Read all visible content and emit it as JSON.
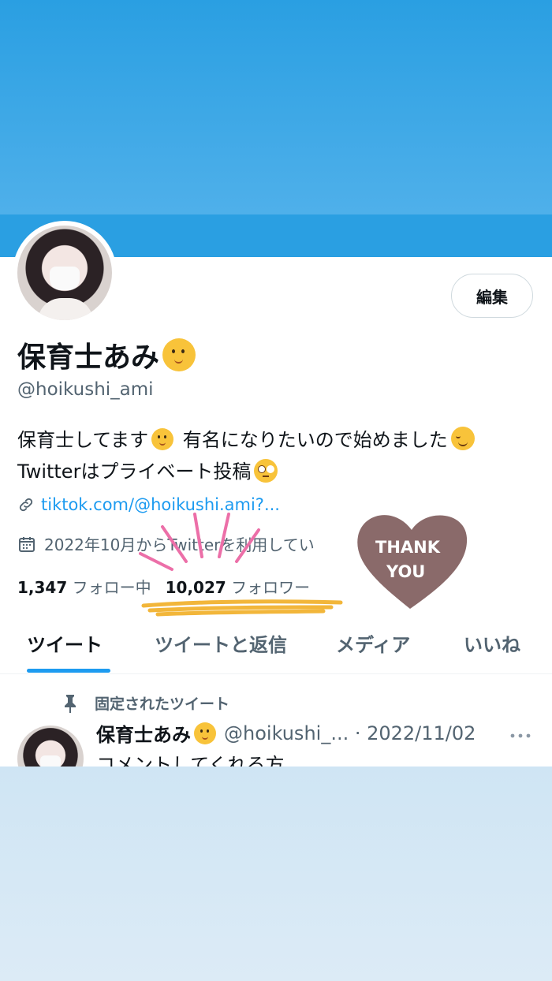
{
  "profile": {
    "name": "保育士あみ",
    "handle": "@hoikushi_ami",
    "edit_label": "編集",
    "bio_line1_a": "保育士してます",
    "bio_line1_b": " 有名になりたいので始めました",
    "bio_line2": "Twitterはプライベート投稿",
    "link": "tiktok.com/@hoikushi.ami?...",
    "joined": "2022年10月からTwitterを利用してい",
    "following_count": "1,347",
    "following_label": "フォロー中",
    "followers_count": "10,027",
    "followers_label": "フォロワー"
  },
  "tabs": [
    {
      "label": "ツイート",
      "active": true
    },
    {
      "label": "ツイートと返信",
      "active": false
    },
    {
      "label": "メディア",
      "active": false
    },
    {
      "label": "いいね",
      "active": false
    }
  ],
  "pinned_label": "固定されたツイート",
  "tweet": {
    "name": "保育士あみ",
    "meta": "@hoikushi_... · 2022/11/02",
    "text": "コメントしてくれる方"
  },
  "sticker": {
    "line1": "THANK",
    "line2": "YOU",
    "color": "#8a6a6a"
  },
  "colors": {
    "accent": "#1d9bf0",
    "banner": "#2a9fe2",
    "highlight_underline": "#f2b63a",
    "sparkle": "#ec6fa8"
  },
  "icons": [
    "link-icon",
    "calendar-icon",
    "pin-icon",
    "more-icon",
    "baby-emoji",
    "smiling-emoji",
    "eye-roll-emoji"
  ]
}
